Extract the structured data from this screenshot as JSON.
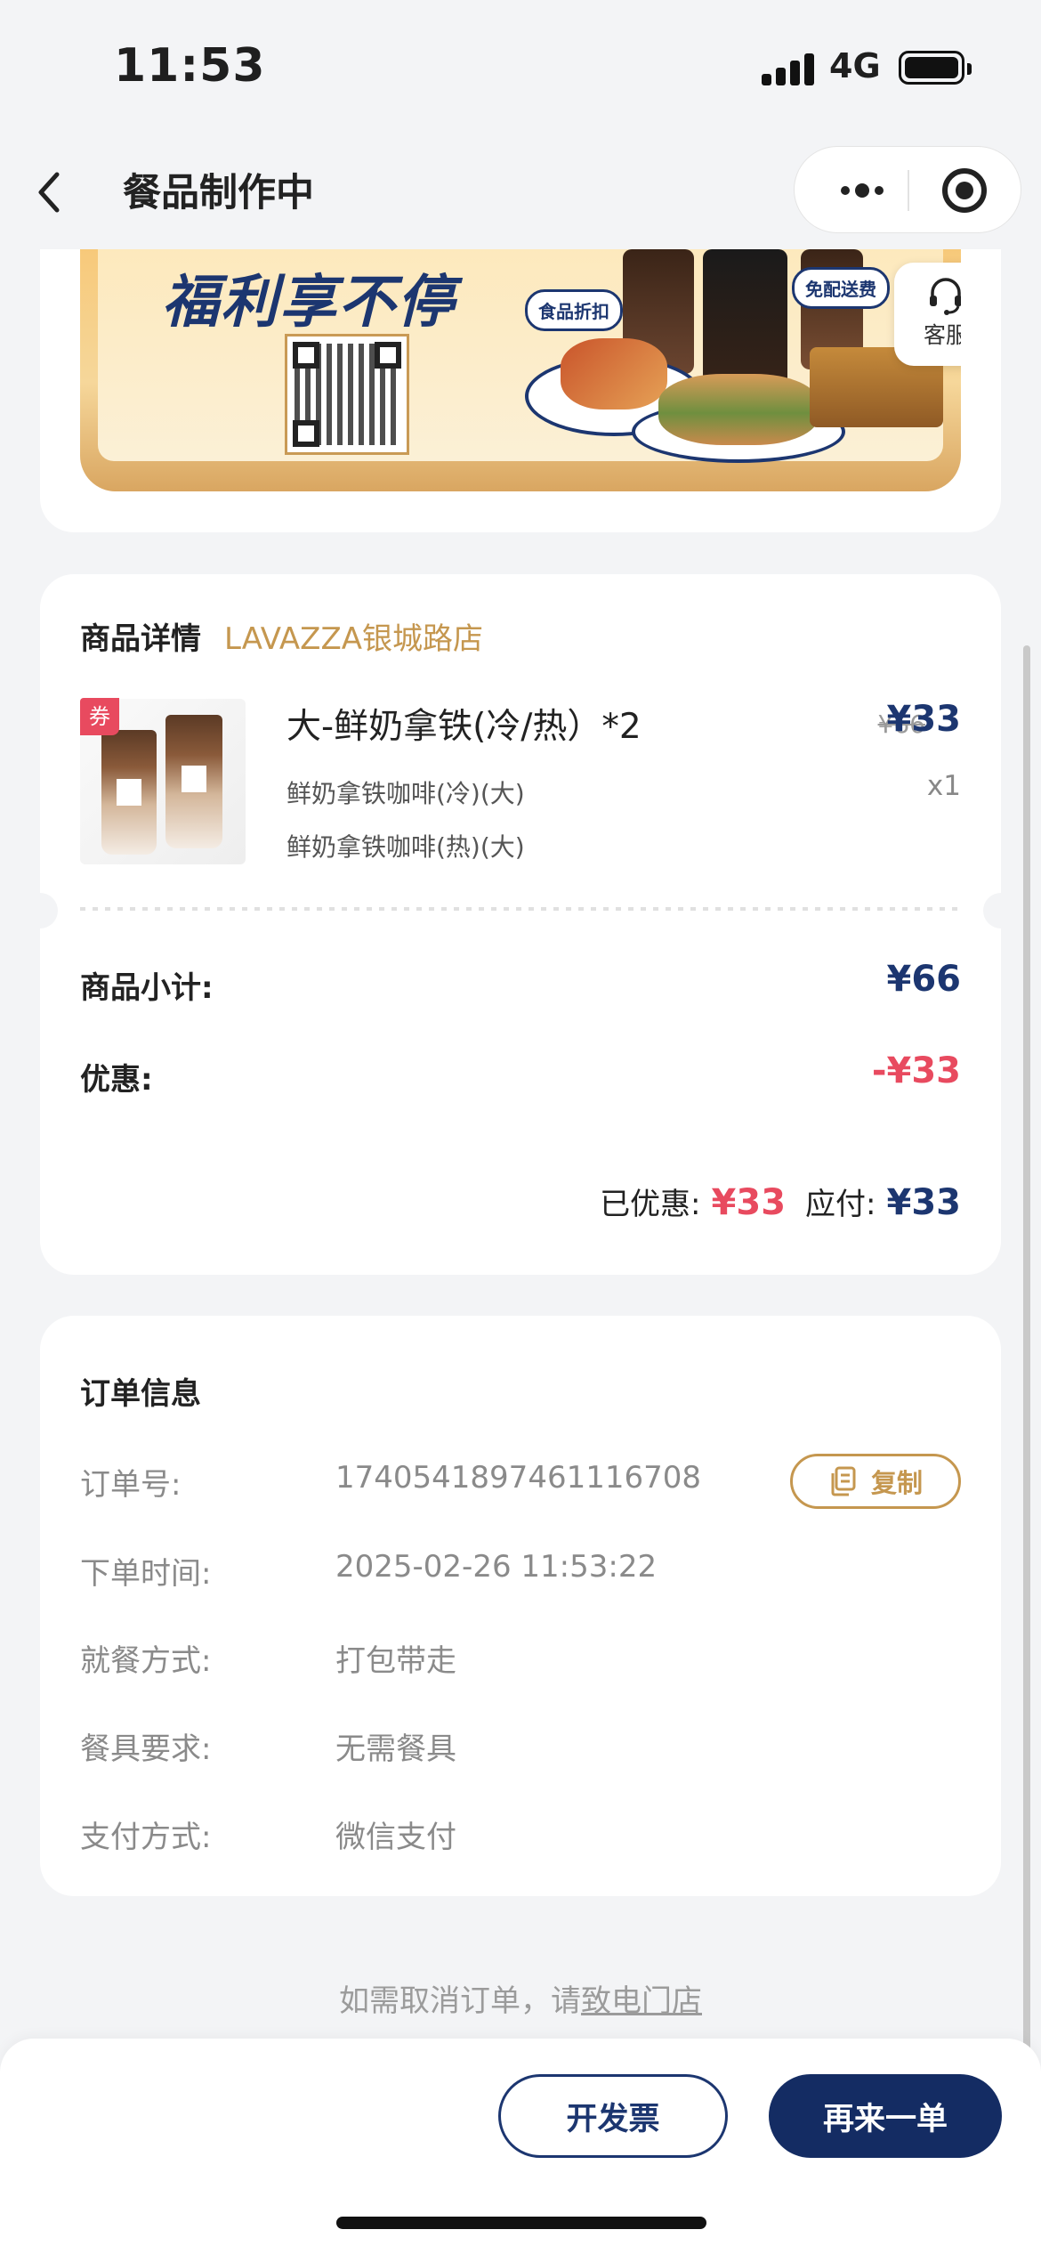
{
  "status_bar": {
    "time": "11:53",
    "network": "4G"
  },
  "nav": {
    "title": "餐品制作中"
  },
  "banner": {
    "headline": "福利享不停",
    "tag_food": "食品折扣",
    "tag_delivery": "免配送费",
    "customer_service": "客服"
  },
  "product": {
    "section_title": "商品详情",
    "store": "LAVAZZA银城路店",
    "coupon_badge": "券",
    "name": "大-鲜奶拿铁(冷/热）*2",
    "variants": [
      "鲜奶拿铁咖啡(冷)(大)",
      "鲜奶拿铁咖啡(热)(大)"
    ],
    "original_price": "¥66",
    "price": "¥33",
    "quantity": "x1",
    "subtotal_label": "商品小计:",
    "subtotal": "¥66",
    "discount_label": "优惠:",
    "discount": "-¥33",
    "saved_label": "已优惠:",
    "saved": "¥33",
    "payable_label": "应付:",
    "payable": "¥33"
  },
  "order_info": {
    "title": "订单信息",
    "rows": [
      {
        "label": "订单号:",
        "value": "1740541897461116708"
      },
      {
        "label": "下单时间:",
        "value": "2025-02-26 11:53:22"
      },
      {
        "label": "就餐方式:",
        "value": "打包带走"
      },
      {
        "label": "餐具要求:",
        "value": "无需餐具"
      },
      {
        "label": "支付方式:",
        "value": "微信支付"
      }
    ],
    "copy_label": "复制"
  },
  "cancel_notice": {
    "text": "如需取消订单，请",
    "link": "致电门店"
  },
  "buttons": {
    "invoice": "开发票",
    "reorder": "再来一单"
  },
  "colors": {
    "brand_navy": "#1c3670",
    "accent_gold": "#c5974f",
    "discount_red": "#e84a5f"
  }
}
